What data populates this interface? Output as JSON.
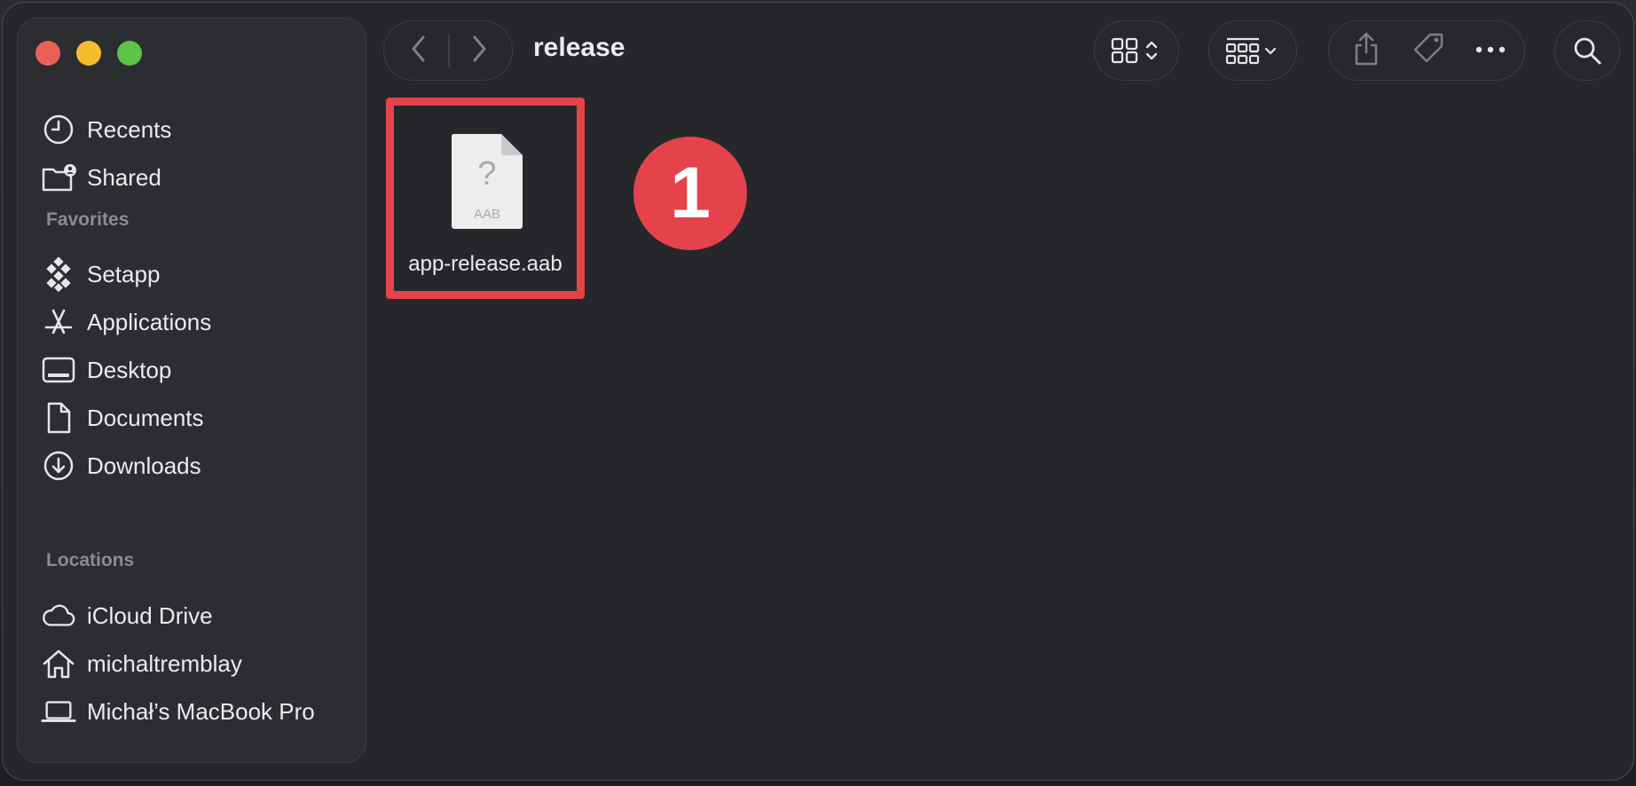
{
  "window": {
    "title": "release"
  },
  "sidebar": {
    "items_top": [
      {
        "label": "Recents",
        "icon": "clock-icon"
      },
      {
        "label": "Shared",
        "icon": "shared-folder-icon"
      }
    ],
    "favorites_heading": "Favorites",
    "favorites": [
      {
        "label": "Setapp",
        "icon": "setapp-icon"
      },
      {
        "label": "Applications",
        "icon": "applications-icon"
      },
      {
        "label": "Desktop",
        "icon": "desktop-icon"
      },
      {
        "label": "Documents",
        "icon": "document-icon"
      },
      {
        "label": "Downloads",
        "icon": "download-icon"
      }
    ],
    "locations_heading": "Locations",
    "locations": [
      {
        "label": "iCloud Drive",
        "icon": "cloud-icon"
      },
      {
        "label": "michaltremblay",
        "icon": "home-icon"
      },
      {
        "label": "Michał’s MacBook Pro",
        "icon": "laptop-icon"
      }
    ]
  },
  "toolbar": {
    "back_icon": "chevron-left-icon",
    "forward_icon": "chevron-right-icon",
    "view_icon": "grid-view-icon",
    "group_icon": "group-by-icon",
    "share_icon": "share-icon",
    "tag_icon": "tag-icon",
    "more_icon": "more-icon",
    "search_icon": "search-icon"
  },
  "content": {
    "files": [
      {
        "name": "app-release.aab",
        "type_label": "AAB",
        "glyph": "?"
      }
    ],
    "annotation_number": "1"
  },
  "colors": {
    "highlight": "#e5434c",
    "window_bg": "#25272b",
    "sidebar_bg": "#2b2d31"
  }
}
